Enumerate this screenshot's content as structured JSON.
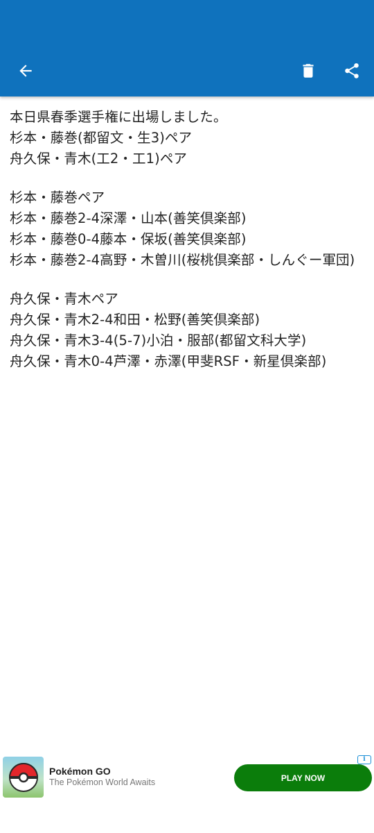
{
  "toolbar": {
    "back_icon": "arrow-back-icon",
    "delete_icon": "trash-icon",
    "share_icon": "share-icon",
    "background": "#0f72bd"
  },
  "post": {
    "paragraphs": [
      {
        "lines": [
          "本日県春季選手権に出場しました。",
          "杉本・藤巻(都留文・生3)ペア",
          "舟久保・青木(工2・工1)ペア"
        ]
      },
      {
        "lines": [
          "杉本・藤巻ペア",
          "杉本・藤巻2-4深澤・山本(善笑倶楽部)",
          "杉本・藤巻0-4藤本・保坂(善笑倶楽部)",
          "杉本・藤巻2-4高野・木曽川(桜桃倶楽部・しんぐー軍団)"
        ]
      },
      {
        "lines": [
          "舟久保・青木ペア",
          "舟久保・青木2-4和田・松野(善笑倶楽部)",
          "舟久保・青木3-4(5-7)小泊・服部(都留文科大学)",
          "舟久保・青木0-4芦澤・赤澤(甲斐RSF・新星倶楽部)"
        ]
      }
    ]
  },
  "ad": {
    "title": "Pokémon GO",
    "subtitle": "The Pokémon World Awaits",
    "cta": "PLAY NOW",
    "info_label": "i",
    "cta_color": "#0b7d0b"
  }
}
